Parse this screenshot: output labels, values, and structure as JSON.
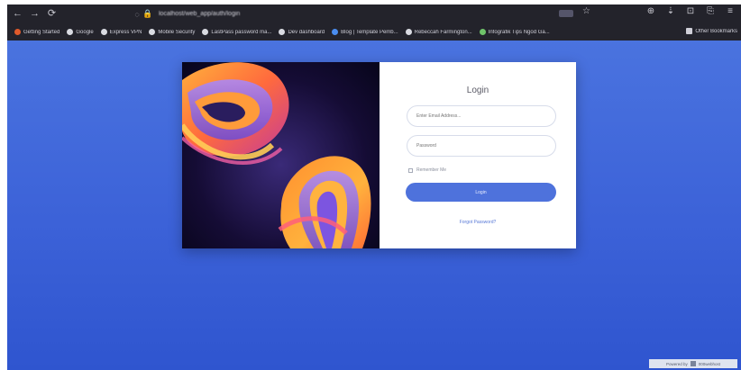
{
  "browser": {
    "nav": {
      "back": "←",
      "forward": "→",
      "reload": "⟳"
    },
    "url_icons": {
      "shield": "◌",
      "lock": "🔒"
    },
    "url": "localhost/web_app/auth/login",
    "star": "☆",
    "toolbar_right": [
      "⊕",
      "⇣",
      "⊡",
      "⎘",
      "≡"
    ],
    "bookmarks": [
      {
        "label": "Getting Started",
        "color": "#e05a2b"
      },
      {
        "label": "Google",
        "color": "#d9dbe2"
      },
      {
        "label": "Express VPN",
        "color": "#d9dbe2"
      },
      {
        "label": "Mobile Security",
        "color": "#d9dbe2"
      },
      {
        "label": "LastPass password ma...",
        "color": "#d9dbe2"
      },
      {
        "label": "Dev dashboard",
        "color": "#d9dbe2"
      },
      {
        "label": "Blog | Template Pemb...",
        "color": "#4a8df0"
      },
      {
        "label": "Rebeccah Farmington...",
        "color": "#d9dbe2"
      },
      {
        "label": "Infografik Tips Ngod Ga...",
        "color": "#6fc36a"
      }
    ],
    "other_bookmarks": "Other Bookmarks"
  },
  "login": {
    "title": "Login",
    "email_placeholder": "Enter Email Address...",
    "password_placeholder": "Password",
    "remember_label": "Remember Me",
    "login_button": "Login",
    "forgot_link": "Forgot Password?"
  },
  "footer_badge": {
    "left": "Powered by",
    "right": "000webhost"
  },
  "colors": {
    "page_top": "#4a73df",
    "page_bottom": "#2f55cf",
    "button": "#4e72dc",
    "link": "#5677d6"
  }
}
